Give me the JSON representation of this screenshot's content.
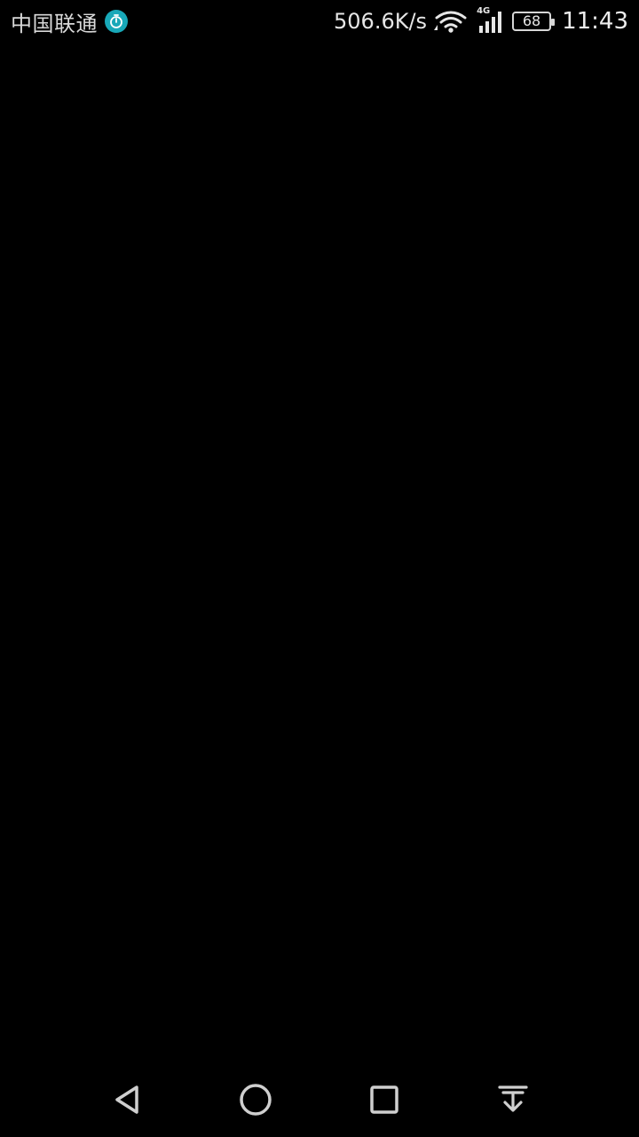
{
  "status_bar": {
    "carrier": "中国联通",
    "net_speed": "506.6K/s",
    "network_type": "4G",
    "battery_level": "68",
    "time": "11:43",
    "icons": {
      "timer": "stopwatch-icon",
      "wifi": "wifi-icon",
      "signal": "cellular-signal-icon",
      "battery": "battery-icon"
    },
    "colors": {
      "timer_badge": "#18a8b8",
      "text": "#e6e6e6"
    }
  },
  "navigation_bar": {
    "buttons": [
      {
        "name": "back",
        "icon": "back-triangle-icon"
      },
      {
        "name": "home",
        "icon": "home-circle-icon"
      },
      {
        "name": "recents",
        "icon": "recents-square-icon"
      },
      {
        "name": "notifications",
        "icon": "pull-down-notifications-icon"
      }
    ]
  }
}
